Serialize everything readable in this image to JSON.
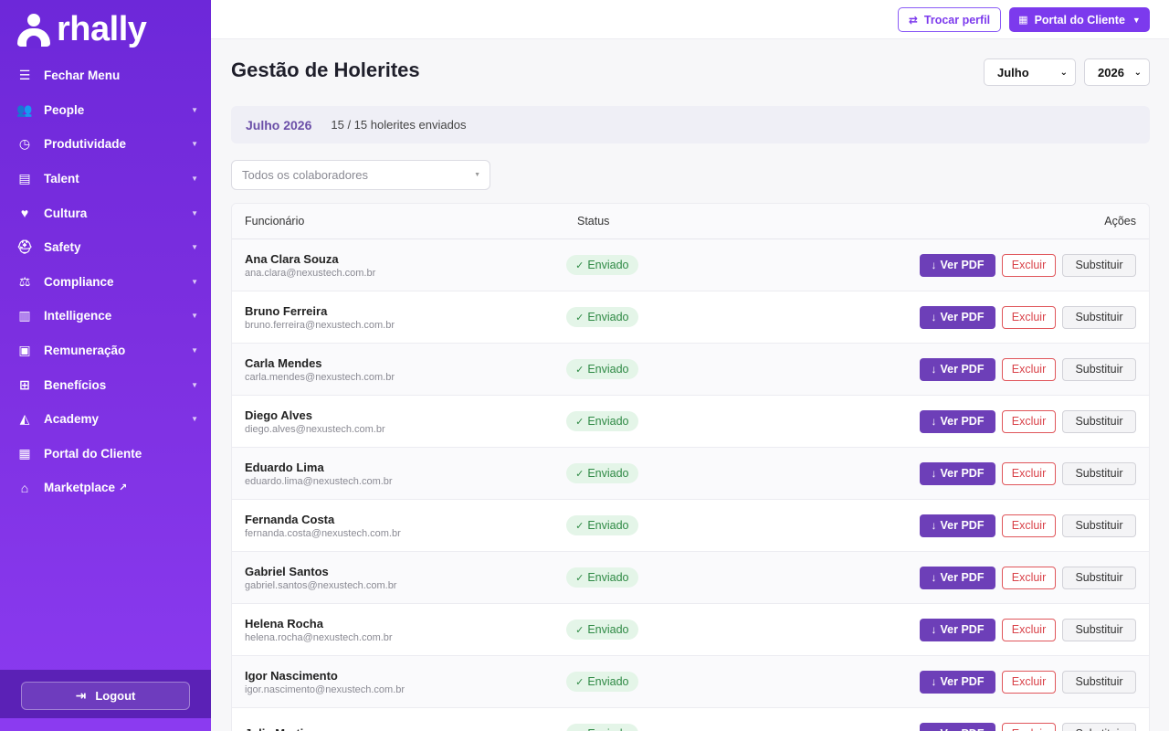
{
  "brand": {
    "name": "rhally"
  },
  "sidebar": {
    "items": [
      {
        "label": "Fechar Menu",
        "icon": "hamburger-icon",
        "glyph": "☰",
        "caret": false,
        "external": false
      },
      {
        "label": "People",
        "icon": "users-icon",
        "glyph": "👥",
        "caret": true,
        "external": false
      },
      {
        "label": "Produtividade",
        "icon": "clock-icon",
        "glyph": "◷",
        "caret": true,
        "external": false
      },
      {
        "label": "Talent",
        "icon": "list-icon",
        "glyph": "▤",
        "caret": true,
        "external": false
      },
      {
        "label": "Cultura",
        "icon": "heart-icon",
        "glyph": "♥",
        "caret": true,
        "external": false
      },
      {
        "label": "Safety",
        "icon": "helmet-icon",
        "glyph": "⛑",
        "caret": true,
        "external": false
      },
      {
        "label": "Compliance",
        "icon": "scale-icon",
        "glyph": "⚖",
        "caret": true,
        "external": false
      },
      {
        "label": "Intelligence",
        "icon": "bar-chart-icon",
        "glyph": "▥",
        "caret": true,
        "external": false
      },
      {
        "label": "Remuneração",
        "icon": "money-icon",
        "glyph": "▣",
        "caret": true,
        "external": false
      },
      {
        "label": "Benefícios",
        "icon": "gift-icon",
        "glyph": "⊞",
        "caret": true,
        "external": false
      },
      {
        "label": "Academy",
        "icon": "graduation-cap-icon",
        "glyph": "◭",
        "caret": true,
        "external": false
      },
      {
        "label": "Portal do Cliente",
        "icon": "building-icon",
        "glyph": "▦",
        "caret": false,
        "external": false
      },
      {
        "label": "Marketplace",
        "icon": "store-icon",
        "glyph": "⌂",
        "caret": false,
        "external": true
      }
    ],
    "logout_label": "Logout"
  },
  "topbar": {
    "swap_label": "Trocar perfil",
    "portal_label": "Portal do Cliente"
  },
  "main": {
    "title": "Gestão de Holerites",
    "month": "Julho",
    "year": "2026",
    "summary_period": "Julho 2026",
    "summary_count": "15 / 15 holerites enviados",
    "filter_placeholder": "Todos os colaboradores",
    "columns": {
      "name": "Funcionário",
      "status": "Status",
      "actions": "Ações"
    },
    "actions": {
      "pdf": "Ver PDF",
      "delete": "Excluir",
      "replace": "Substituir"
    },
    "status_sent": "Enviado",
    "rows": [
      {
        "name": "Ana Clara Souza",
        "email": "ana.clara@nexustech.com.br"
      },
      {
        "name": "Bruno Ferreira",
        "email": "bruno.ferreira@nexustech.com.br"
      },
      {
        "name": "Carla Mendes",
        "email": "carla.mendes@nexustech.com.br"
      },
      {
        "name": "Diego Alves",
        "email": "diego.alves@nexustech.com.br"
      },
      {
        "name": "Eduardo Lima",
        "email": "eduardo.lima@nexustech.com.br"
      },
      {
        "name": "Fernanda Costa",
        "email": "fernanda.costa@nexustech.com.br"
      },
      {
        "name": "Gabriel Santos",
        "email": "gabriel.santos@nexustech.com.br"
      },
      {
        "name": "Helena Rocha",
        "email": "helena.rocha@nexustech.com.br"
      },
      {
        "name": "Igor Nascimento",
        "email": "igor.nascimento@nexustech.com.br"
      },
      {
        "name": "Julia Martins",
        "email": ""
      }
    ]
  },
  "colors": {
    "sidebar": "#6d28d9",
    "accent": "#7c3aed",
    "pdf_button": "#6d3fb8",
    "danger": "#d9434a",
    "success": "#2f8a45"
  }
}
